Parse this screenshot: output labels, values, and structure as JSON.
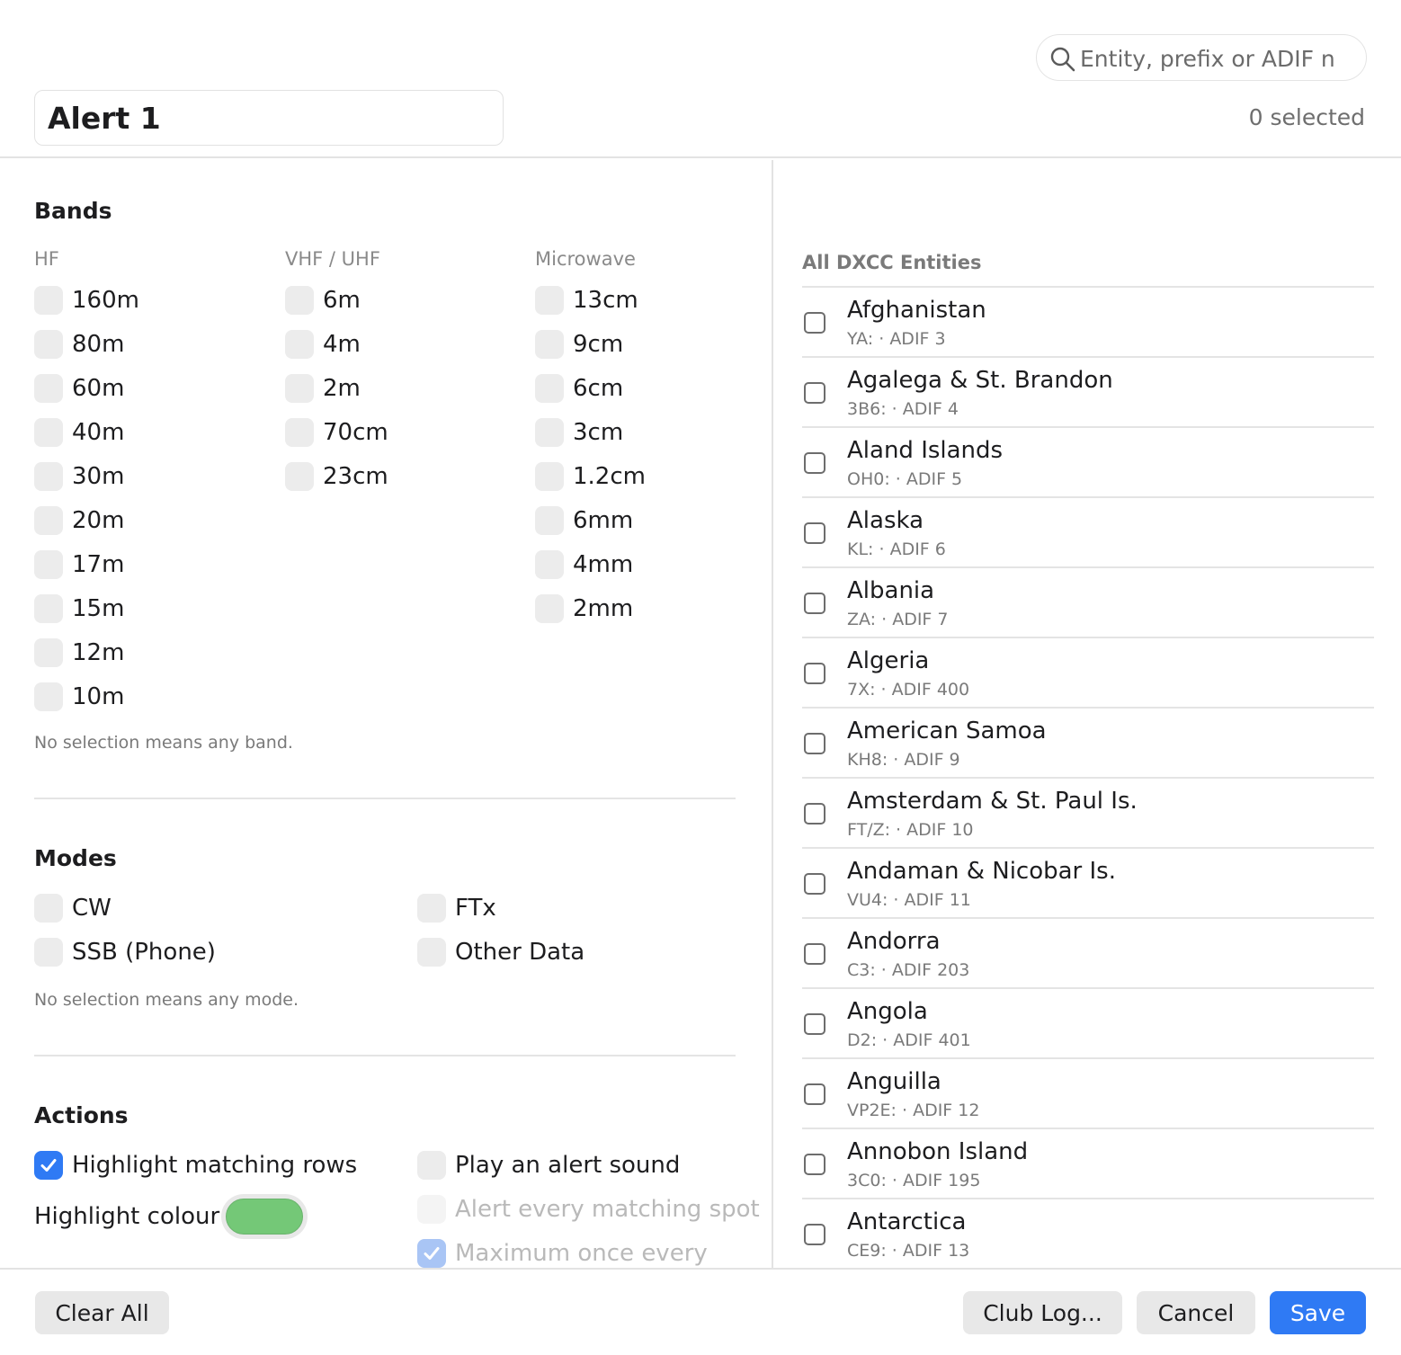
{
  "header": {
    "alert_name": "Alert 1",
    "search_placeholder": "Entity, prefix or ADIF n",
    "selected_count": "0 selected"
  },
  "bands": {
    "title": "Bands",
    "columns": [
      {
        "label": "HF",
        "items": [
          "160m",
          "80m",
          "60m",
          "40m",
          "30m",
          "20m",
          "17m",
          "15m",
          "12m",
          "10m"
        ]
      },
      {
        "label": "VHF / UHF",
        "items": [
          "6m",
          "4m",
          "2m",
          "70cm",
          "23cm"
        ]
      },
      {
        "label": "Microwave",
        "items": [
          "13cm",
          "9cm",
          "6cm",
          "3cm",
          "1.2cm",
          "6mm",
          "4mm",
          "2mm"
        ]
      }
    ],
    "hint": "No selection means any band."
  },
  "modes": {
    "title": "Modes",
    "items": [
      "CW",
      "SSB (Phone)",
      "FTx",
      "Other Data"
    ],
    "hint": "No selection means any mode."
  },
  "actions": {
    "title": "Actions",
    "highlight_rows": "Highlight matching rows",
    "highlight_colour_label": "Highlight colour",
    "highlight_colour": "#74c877",
    "play_sound": "Play an alert sound",
    "alert_every": "Alert every matching spot",
    "max_once": "Maximum once every"
  },
  "entities": {
    "title": "All DXCC Entities",
    "items": [
      {
        "name": "Afghanistan",
        "meta": "YA: · ADIF 3"
      },
      {
        "name": "Agalega & St. Brandon",
        "meta": "3B6: · ADIF 4"
      },
      {
        "name": "Aland Islands",
        "meta": "OH0: · ADIF 5"
      },
      {
        "name": "Alaska",
        "meta": "KL: · ADIF 6"
      },
      {
        "name": "Albania",
        "meta": "ZA: · ADIF 7"
      },
      {
        "name": "Algeria",
        "meta": "7X: · ADIF 400"
      },
      {
        "name": "American Samoa",
        "meta": "KH8: · ADIF 9"
      },
      {
        "name": "Amsterdam & St. Paul Is.",
        "meta": "FT/Z: · ADIF 10"
      },
      {
        "name": "Andaman & Nicobar Is.",
        "meta": "VU4: · ADIF 11"
      },
      {
        "name": "Andorra",
        "meta": "C3: · ADIF 203"
      },
      {
        "name": "Angola",
        "meta": "D2: · ADIF 401"
      },
      {
        "name": "Anguilla",
        "meta": "VP2E: · ADIF 12"
      },
      {
        "name": "Annobon Island",
        "meta": "3C0: · ADIF 195"
      },
      {
        "name": "Antarctica",
        "meta": "CE9: · ADIF 13"
      }
    ]
  },
  "footer": {
    "clear_all": "Clear All",
    "club_log": "Club Log...",
    "cancel": "Cancel",
    "save": "Save"
  },
  "colors": {
    "accent": "#2f7af4",
    "highlight_swatch": "#74c877"
  }
}
